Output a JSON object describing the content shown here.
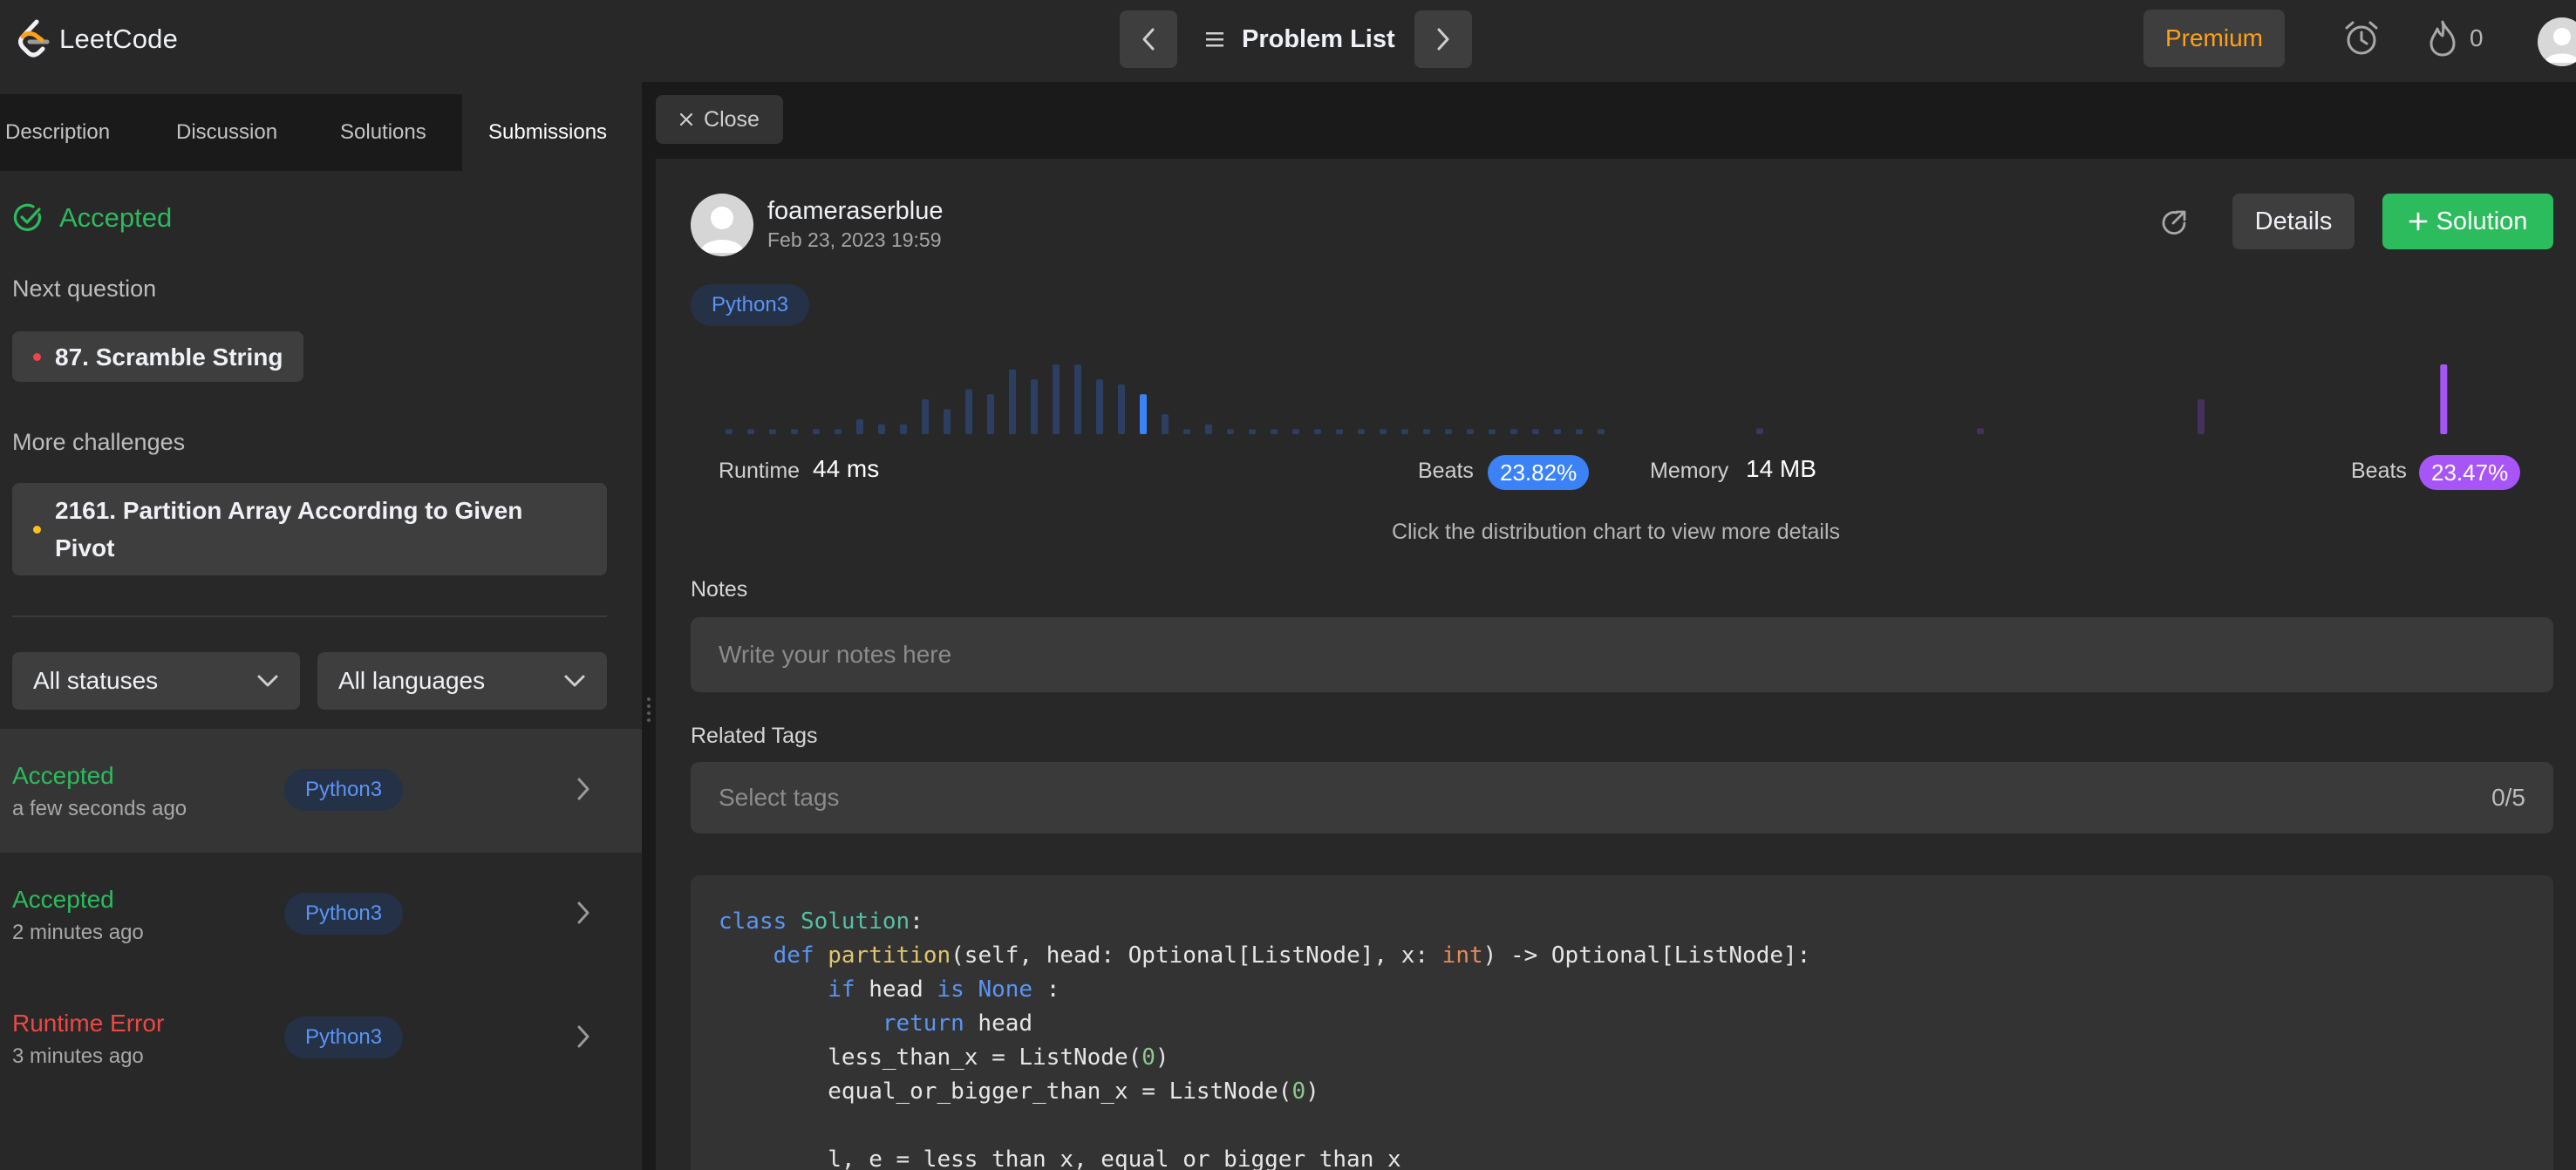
{
  "app": {
    "name": "LeetCode"
  },
  "nav": {
    "problem_list": "Problem List",
    "premium": "Premium",
    "streak_count": "0"
  },
  "tabs": [
    {
      "label": "Description"
    },
    {
      "label": "Discussion"
    },
    {
      "label": "Solutions"
    },
    {
      "label": "Submissions"
    }
  ],
  "left": {
    "result": "Accepted",
    "next_question_label": "Next question",
    "next_question": "87. Scramble String",
    "more_challenges_label": "More challenges",
    "challenge_line1": "2161. Partition Array According to Given",
    "challenge_line2": "Pivot",
    "status_filter": "All statuses",
    "language_filter": "All languages",
    "submissions": [
      {
        "status": "Accepted",
        "time": "a few seconds ago",
        "lang": "Python3"
      },
      {
        "status": "Accepted",
        "time": "2 minutes ago",
        "lang": "Python3"
      },
      {
        "status": "Runtime Error",
        "time": "3 minutes ago",
        "lang": "Python3"
      }
    ]
  },
  "detail": {
    "close": "Close",
    "user": "foameraserblue",
    "date": "Feb 23, 2023 19:59",
    "details_btn": "Details",
    "solution_btn": "Solution",
    "language": "Python3",
    "runtime_label": "Runtime",
    "runtime_value": "44 ms",
    "memory_label": "Memory",
    "memory_value": "14 MB",
    "beats_label": "Beats",
    "runtime_beats": "23.82%",
    "memory_beats": "23.47%",
    "chart_hint": "Click the distribution chart to view more details",
    "notes_label": "Notes",
    "notes_placeholder": "Write your notes here",
    "tags_label": "Related Tags",
    "tags_placeholder": "Select tags",
    "tags_count": "0/5"
  },
  "code": {
    "line1": {
      "kw": "class",
      "name": "Solution",
      "rest": ":"
    },
    "line2": {
      "kw": "def",
      "fn": "partition",
      "a": "(self, head: Optional[ListNode], x: ",
      "bi": "int",
      "b": ") -> Optional[ListNode]:"
    },
    "line3": {
      "kw": "if",
      "a": " head ",
      "kw2": "is",
      "b": " ",
      "kw3": "None",
      "c": " :"
    },
    "line4": {
      "kw": "return",
      "a": " head"
    },
    "line5": {
      "a": "less_than_x = ListNode(",
      "n": "0",
      "b": ")"
    },
    "line6": {
      "a": "equal_or_bigger_than_x = ListNode(",
      "n": "0",
      "b": ")"
    },
    "line7": {
      "a": "l, e = less_than_x, equal_or_bigger_than_x"
    }
  },
  "colors": {
    "accepted": "#2cbb5d",
    "error": "#ef4743",
    "runtime_accent": "#3b82f6",
    "memory_accent": "#a855f7",
    "premium": "#ffa116"
  },
  "chart_data": [
    {
      "type": "bar",
      "values": [
        1,
        1,
        1,
        1,
        1,
        1,
        3,
        2,
        2,
        7,
        5,
        9,
        8,
        13,
        11,
        14,
        14,
        11,
        10,
        8,
        4,
        1,
        2,
        1,
        1,
        1,
        1,
        1,
        1,
        1,
        1,
        1,
        1,
        1,
        1,
        1,
        1,
        1,
        1,
        1,
        1
      ],
      "highlight_index": 19
    },
    {
      "type": "bar",
      "values": [
        1,
        0,
        0,
        0,
        0,
        0,
        0,
        0,
        0,
        0,
        1,
        0,
        0,
        0,
        0,
        0,
        0,
        0,
        0,
        0,
        6,
        0,
        0,
        0,
        0,
        0,
        0,
        0,
        0,
        0,
        0,
        12
      ],
      "highlight_index": 31
    }
  ]
}
